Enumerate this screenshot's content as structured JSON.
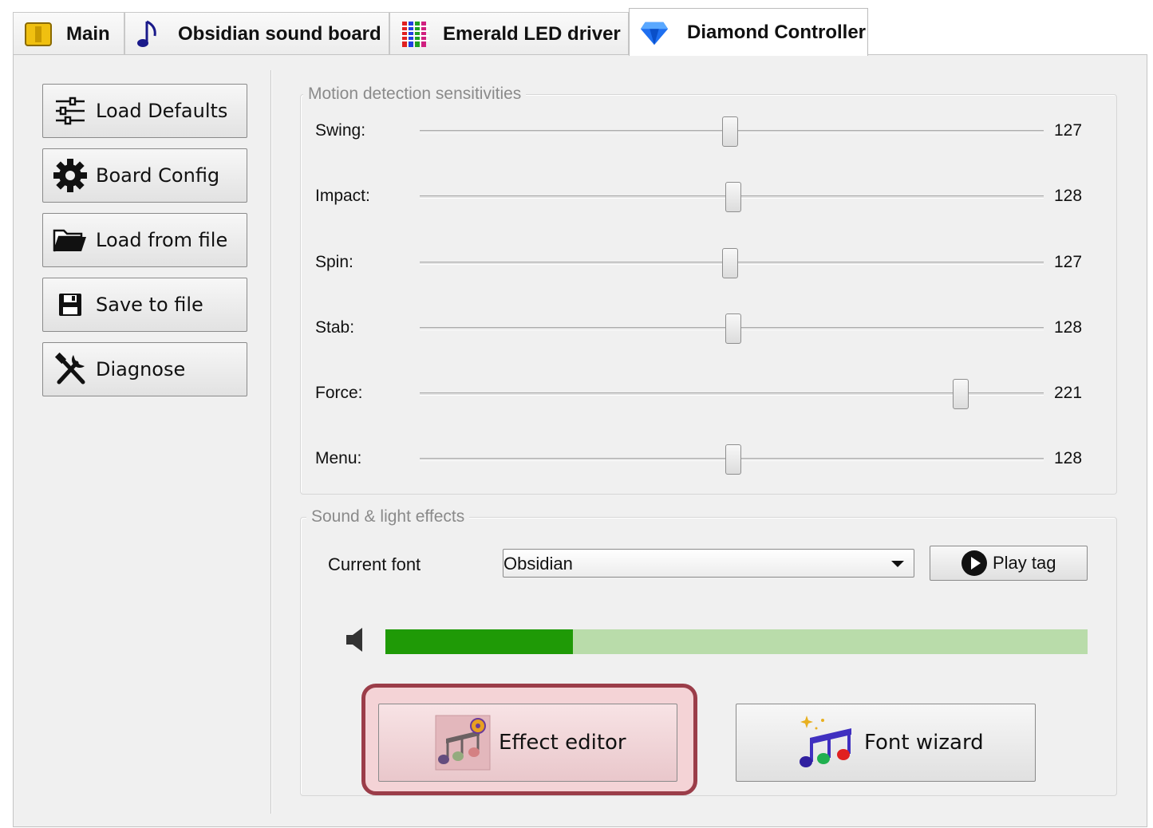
{
  "tabs": [
    {
      "label": "Main",
      "icon": "yellow-board-icon"
    },
    {
      "label": "Obsidian sound board",
      "icon": "music-note-icon"
    },
    {
      "label": "Emerald LED driver",
      "icon": "led-matrix-icon"
    },
    {
      "label": "Diamond Controller",
      "icon": "diamond-icon",
      "active": true
    }
  ],
  "sidebar": {
    "buttons": [
      {
        "label": "Load Defaults",
        "icon": "sliders-icon"
      },
      {
        "label": "Board Config",
        "icon": "gear-icon"
      },
      {
        "label": "Load from file",
        "icon": "folder-open-icon"
      },
      {
        "label": "Save to file",
        "icon": "floppy-disk-icon"
      },
      {
        "label": "Diagnose",
        "icon": "tools-icon"
      }
    ]
  },
  "motion": {
    "title": "Motion detection sensitivities",
    "sliders": [
      {
        "label": "Swing:",
        "value": 127,
        "display": "127"
      },
      {
        "label": "Impact:",
        "value": 128,
        "display": "128"
      },
      {
        "label": "Spin:",
        "value": 127,
        "display": "127"
      },
      {
        "label": "Stab:",
        "value": 128,
        "display": "128"
      },
      {
        "label": "Force:",
        "value": 221,
        "display": "221"
      },
      {
        "label": "Menu:",
        "value": 128,
        "display": "128"
      }
    ],
    "range": [
      0,
      255
    ]
  },
  "effects": {
    "title": "Sound & light effects",
    "font_label": "Current font",
    "font_value": "Obsidian",
    "play_label": "Play tag",
    "volume_fraction": 0.267,
    "effect_editor_label": "Effect editor",
    "font_wizard_label": "Font wizard"
  },
  "colors": {
    "volume_fill": "#1f9a06",
    "volume_track": "#b9dcaa",
    "highlight_border": "#9b3d49",
    "highlight_fill": "#f4d3d6"
  }
}
